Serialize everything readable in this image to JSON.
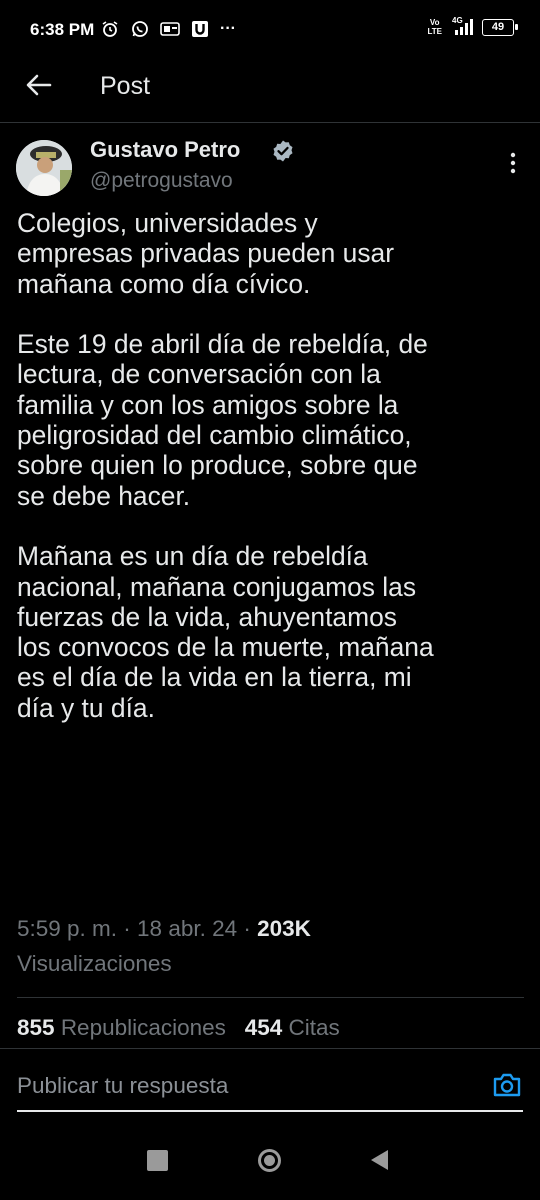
{
  "status": {
    "time": "6:38 PM",
    "volte_top": "Vo",
    "volte_bottom": "LTE",
    "network": "4G",
    "battery": "49",
    "more_dots": "···"
  },
  "header": {
    "title": "Post"
  },
  "post": {
    "author_name": "Gustavo Petro",
    "author_handle": "@petrogustavo",
    "text": "Colegios, universidades y\nempresas privadas pueden usar\nmañana como día cívico.\n\nEste 19 de abril día de rebeldía, de\nlectura, de conversación con la\nfamilia y con los amigos sobre la\npeligrosidad del cambio climático,\nsobre quien lo produce, sobre que\nse debe hacer.\n\nMañana es un día de rebeldía\nnacional, mañana conjugamos las\nfuerzas de la vida, ahuyentamos\nlos convocos de la muerte, mañana\nes el día de la vida en la tierra, mi\ndía y tu día.",
    "timestamp": "5:59 p. m. · 18 abr. 24 · ",
    "views_count": "203K",
    "views_label": "Visualizaciones",
    "reposts_count": "855",
    "reposts_label": "Republicaciones",
    "quotes_count": "454",
    "quotes_label": "Citas"
  },
  "reply": {
    "placeholder": "Publicar tu respuesta"
  },
  "colors": {
    "background": "#000000",
    "text": "#e7e9ea",
    "secondary": "#71767b",
    "accent": "#1d9bf0"
  }
}
